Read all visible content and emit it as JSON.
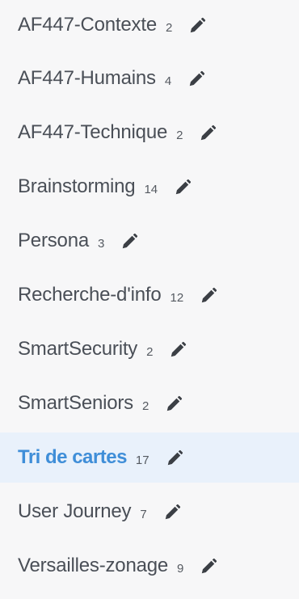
{
  "collections": [
    {
      "name": "AF447-Contexte",
      "count": "2"
    },
    {
      "name": "AF447-Humains",
      "count": "4"
    },
    {
      "name": "AF447-Technique",
      "count": "2"
    },
    {
      "name": "Brainstorming",
      "count": "14"
    },
    {
      "name": "Persona",
      "count": "3"
    },
    {
      "name": "Recherche-d'info",
      "count": "12"
    },
    {
      "name": "SmartSecurity",
      "count": "2"
    },
    {
      "name": "SmartSeniors",
      "count": "2"
    },
    {
      "name": "Tri de cartes",
      "count": "17",
      "active": true
    },
    {
      "name": "User Journey",
      "count": "7"
    },
    {
      "name": "Versailles-zonage",
      "count": "9"
    }
  ],
  "icons": {
    "edit": "pencil-icon"
  },
  "colors": {
    "background": "#f7f7f8",
    "text": "#4a4f57",
    "active_text": "#3f8ed8",
    "active_background": "#e9f1fb",
    "icon": "#3b3f45"
  }
}
